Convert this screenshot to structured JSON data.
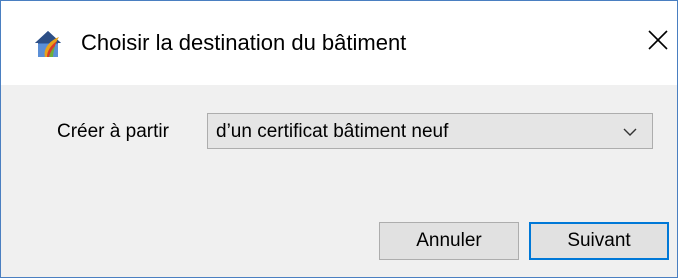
{
  "window": {
    "title": "Choisir la destination du bâtiment",
    "app_icon": "building-house-icon",
    "close_icon": "close-icon",
    "accent_color": "#0078d7"
  },
  "form": {
    "source_label": "Créer à partir",
    "source_select": {
      "selected": "d’un certificat bâtiment neuf",
      "icon": "chevron-down-icon"
    }
  },
  "buttons": {
    "cancel_label": "Annuler",
    "next_label": "Suivant"
  }
}
